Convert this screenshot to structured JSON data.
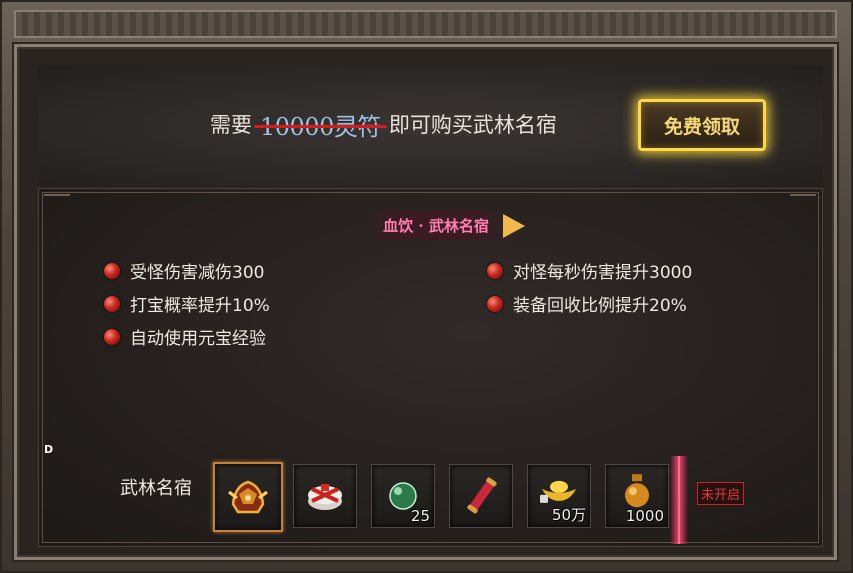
{
  "banner": {
    "prefix": "需要",
    "old_price": "10000灵符",
    "suffix": "即可购买武林名宿",
    "claim_button": "免费领取"
  },
  "section": {
    "title": "血饮 · 武林名宿"
  },
  "perks_left": [
    "受怪伤害减伤300",
    "打宝概率提升10%",
    "自动使用元宝经验"
  ],
  "perks_right": [
    "对怪每秒伤害提升3000",
    "装备回收比例提升20%"
  ],
  "rewards": {
    "label": "武林名宿",
    "items": [
      {
        "icon": "helmet-icon",
        "qty": ""
      },
      {
        "icon": "gift-box-icon",
        "qty": ""
      },
      {
        "icon": "jade-orb-icon",
        "qty": "25"
      },
      {
        "icon": "scroll-icon",
        "qty": ""
      },
      {
        "icon": "gold-ingot-icon",
        "qty": "50万"
      },
      {
        "icon": "potion-icon",
        "qty": "1000"
      }
    ],
    "status": "未开启"
  },
  "marker": "D",
  "colors": {
    "accent_gold": "#ffd94a",
    "strike_red": "#d81c1c",
    "title_pink": "#ff7fb0",
    "bullet_red": "#c8251c"
  }
}
